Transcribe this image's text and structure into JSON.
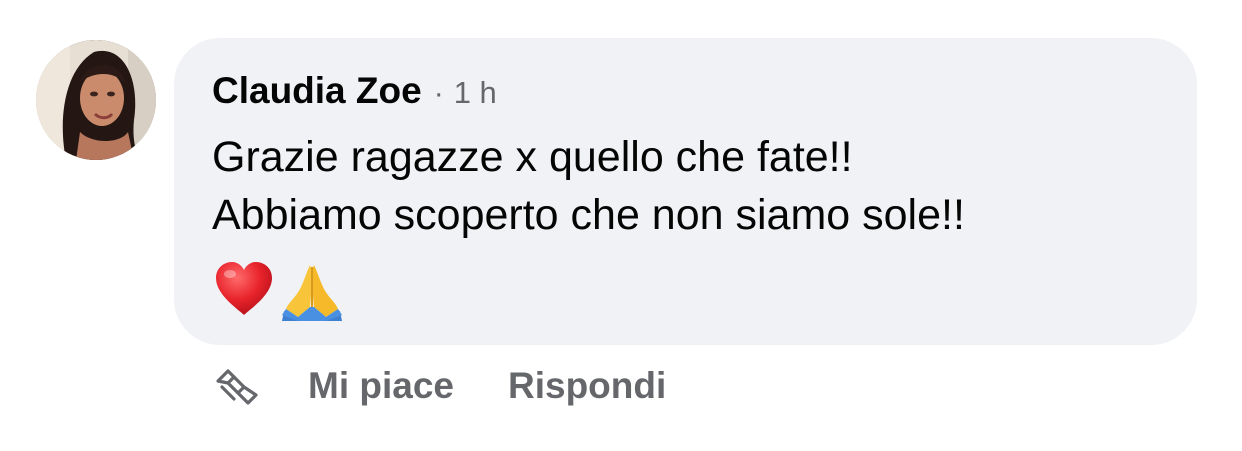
{
  "comment": {
    "author": "Claudia Zoe",
    "separator": "·",
    "timestamp": "1 h",
    "text_lines": [
      "Grazie ragazze x quello che fate!!",
      "Abbiamo scoperto che non siamo sole!!"
    ],
    "emojis": [
      "red-heart",
      "folded-hands"
    ],
    "bubble_color": "#f0f2f5",
    "text_color": "#050505",
    "secondary_color": "#65676b"
  },
  "actions": {
    "like_icon": "like-icon",
    "like_label": "Mi piace",
    "reply_label": "Rispondi"
  }
}
